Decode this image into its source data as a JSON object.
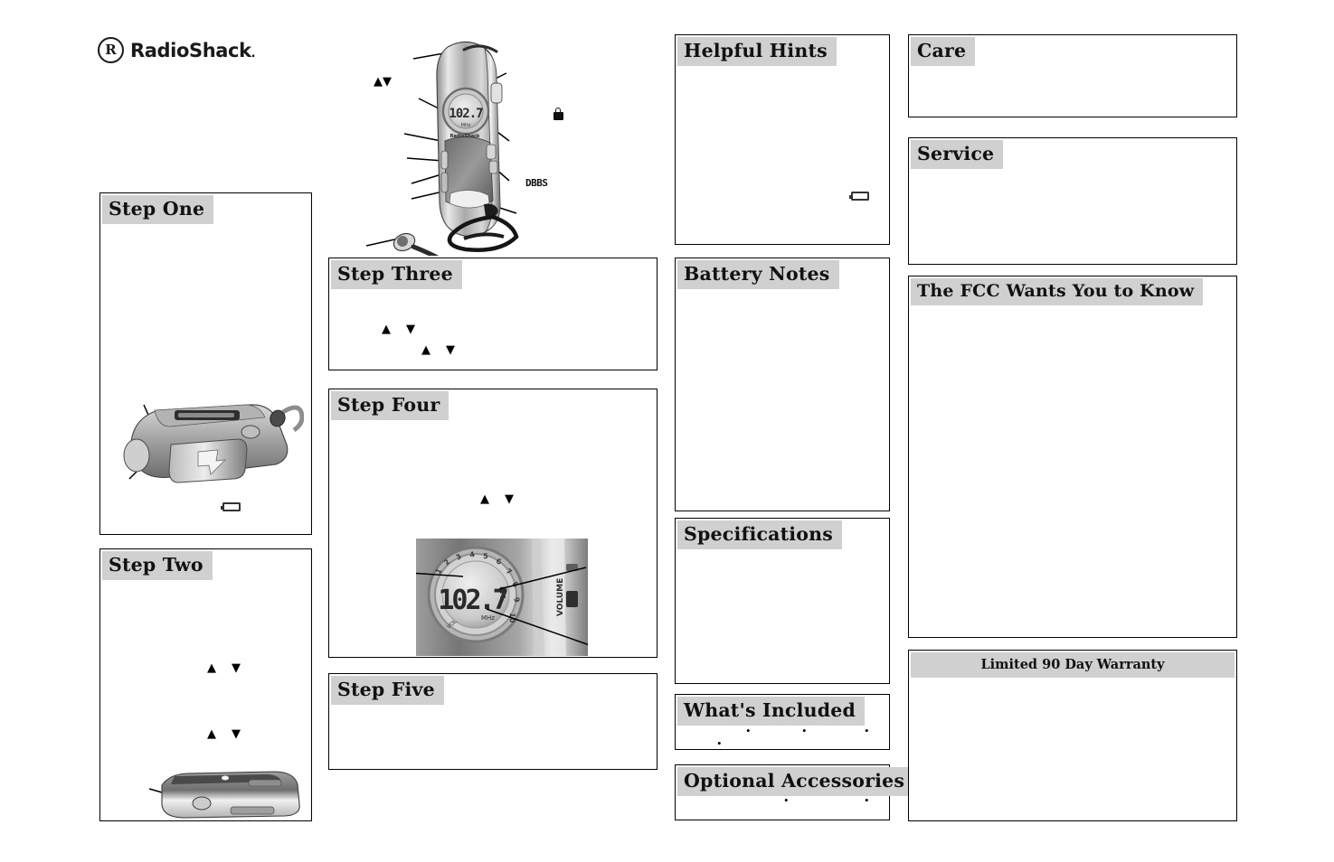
{
  "brand": {
    "mark": "R",
    "name": "RadioShack",
    "trailing_dot": "."
  },
  "sections": {
    "step_one": {
      "title": "Step One"
    },
    "step_two": {
      "title": "Step Two"
    },
    "step_three": {
      "title": "Step Three"
    },
    "step_four": {
      "title": "Step Four"
    },
    "step_five": {
      "title": "Step Five"
    },
    "helpful_hints": {
      "title": "Helpful Hints"
    },
    "battery_notes": {
      "title": "Battery Notes"
    },
    "specifications": {
      "title": "Specifications"
    },
    "whats_included": {
      "title": "What's Included"
    },
    "optional_accessories": {
      "title": "Optional Accessories"
    },
    "care": {
      "title": "Care"
    },
    "service": {
      "title": "Service"
    },
    "fcc": {
      "title": "The FCC Wants You to Know"
    },
    "warranty": {
      "title": "Limited 90 Day Warranty"
    }
  },
  "diagram": {
    "dbbs_label": "DBBS",
    "lock_icon": "lock-icon",
    "tune_arrows": "▲▼",
    "brand_on_device": "RadioShack",
    "display_frequency": "102.7",
    "display_units": "MHz",
    "display_band": "FM",
    "volume_label": "VOLUME",
    "preset_ticks": [
      "1",
      "2",
      "3",
      "4",
      "5",
      "6",
      "7",
      "8",
      "9",
      "10"
    ]
  },
  "glyphs": {
    "up": "▲",
    "down": "▼",
    "bullet": "•",
    "battery": "battery-icon"
  },
  "colors": {
    "header_band": "#d0d0d0",
    "border": "#000000",
    "text": "#111111",
    "page_background": "#ffffff"
  }
}
